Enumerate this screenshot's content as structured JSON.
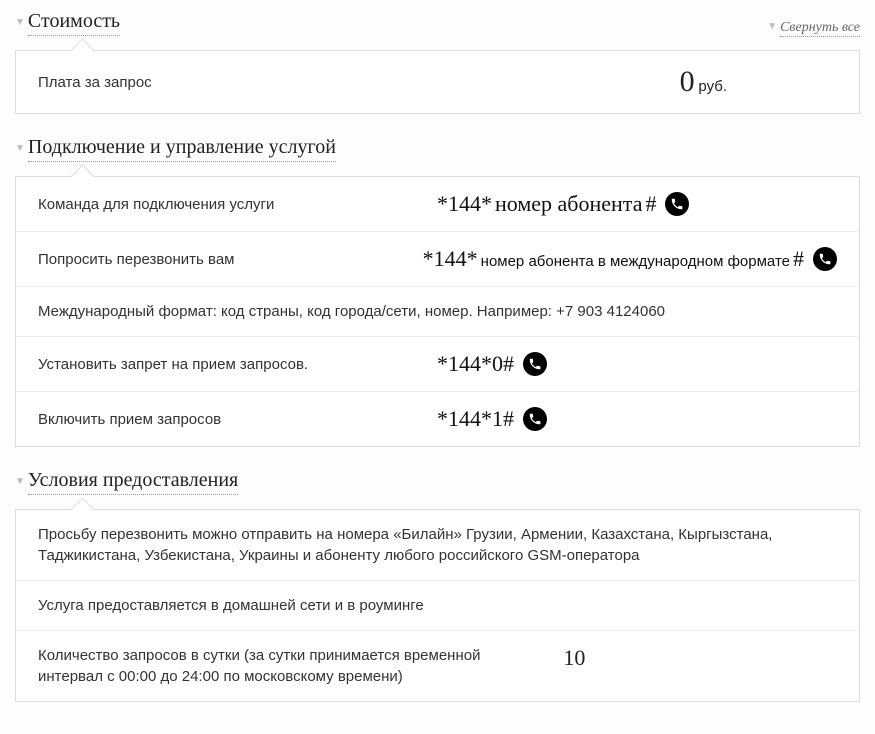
{
  "collapse_all": "Свернуть все",
  "sections": {
    "cost": {
      "title": "Стоимость",
      "row_label": "Плата за запрос",
      "amount": "0",
      "unit": "руб."
    },
    "manage": {
      "title": "Подключение и управление услугой",
      "r1_label": "Команда для подключения услуги",
      "r1_code_a": "*144*",
      "r1_code_b": "номер абонента",
      "r1_code_c": "#",
      "r2_label": "Попросить перезвонить вам",
      "r2_code_a": "*144*",
      "r2_code_b": "номер абонента в международном формате",
      "r2_code_c": "#",
      "r3_text": "Международный формат: код страны, код города/сети, номер. Например: +7 903 4124060",
      "r4_label": "Установить запрет на прием запросов.",
      "r4_code": "*144*0#",
      "r5_label": "Включить прием запросов",
      "r5_code": "*144*1#"
    },
    "terms": {
      "title": "Условия предоставления",
      "r1": "Просьбу перезвонить можно отправить на номера «Билайн» Грузии, Армении, Казахстана, Кыргызстана, Таджикистана, Узбекистана, Украины и абоненту любого российского GSM-оператора",
      "r2": "Услуга предоставляется в домашней сети и в роуминге",
      "r3_label": "Количество запросов в сутки (за сутки принимается временной интервал с 00:00 до 24:00 по московскому времени)",
      "r3_val": "10"
    }
  }
}
